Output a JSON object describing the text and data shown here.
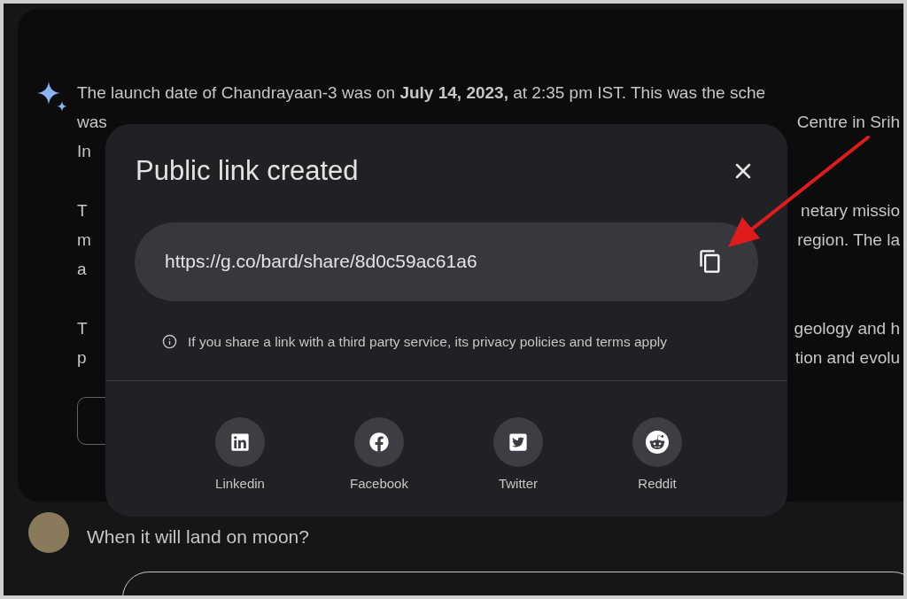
{
  "response": {
    "paragraphs": [
      [
        {
          "left": "The launch date of Chandrayaan-3 was on **July 14, 2023,** at 2:35 pm IST. This was the sche"
        },
        {
          "left": "was",
          "right": "Centre in Srih"
        },
        {
          "left": "In"
        }
      ],
      [
        {
          "left": "T",
          "right": "netary missio"
        },
        {
          "left": "m",
          "right": "region. The la"
        },
        {
          "left": "a"
        }
      ],
      [
        {
          "left": "T",
          "right": "geology and h"
        },
        {
          "left": "p",
          "right": "tion and evolu"
        }
      ]
    ]
  },
  "dialog": {
    "title": "Public link created",
    "link": "https://g.co/bard/share/8d0c59ac61a6",
    "notice": "If you share a link with a third party service, its privacy policies and terms apply",
    "share": [
      {
        "kind": "linkedin",
        "label": "Linkedin"
      },
      {
        "kind": "facebook",
        "label": "Facebook"
      },
      {
        "kind": "twitter",
        "label": "Twitter"
      },
      {
        "kind": "reddit",
        "label": "Reddit"
      }
    ]
  },
  "prompt": {
    "text": "When it will land on moon?"
  }
}
